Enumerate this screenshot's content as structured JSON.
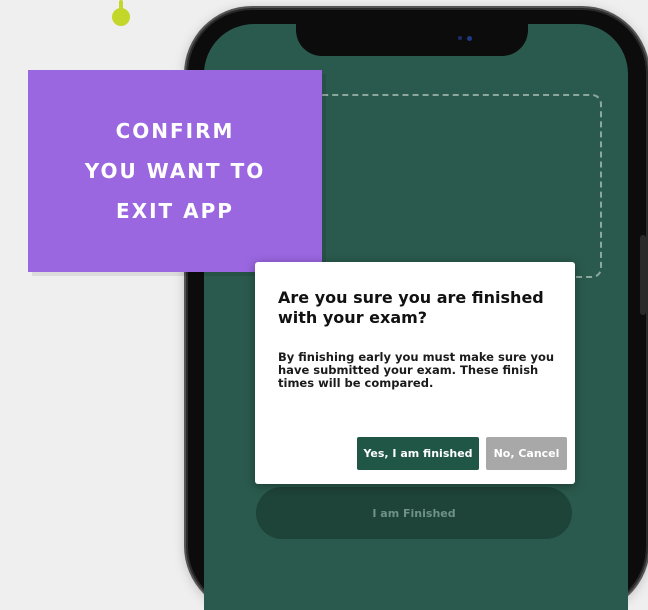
{
  "callout": {
    "lines": [
      "CONFIRM",
      "YOU WANT TO",
      "EXIT APP"
    ]
  },
  "dialog": {
    "title": "Are you sure you are finished with your exam?",
    "body": "By finishing early you must make sure you have submitted your exam. These finish times will be compared.",
    "confirm_label": "Yes, I am finished",
    "cancel_label": "No, Cancel"
  },
  "app": {
    "finish_label": "I am Finished"
  },
  "colors": {
    "accent_purple": "#9a67e0",
    "screen_green": "#2a5a4d",
    "confirm_green": "#1f5645",
    "cancel_gray": "#a8a8a8",
    "connector_lime": "#c3d62a"
  }
}
